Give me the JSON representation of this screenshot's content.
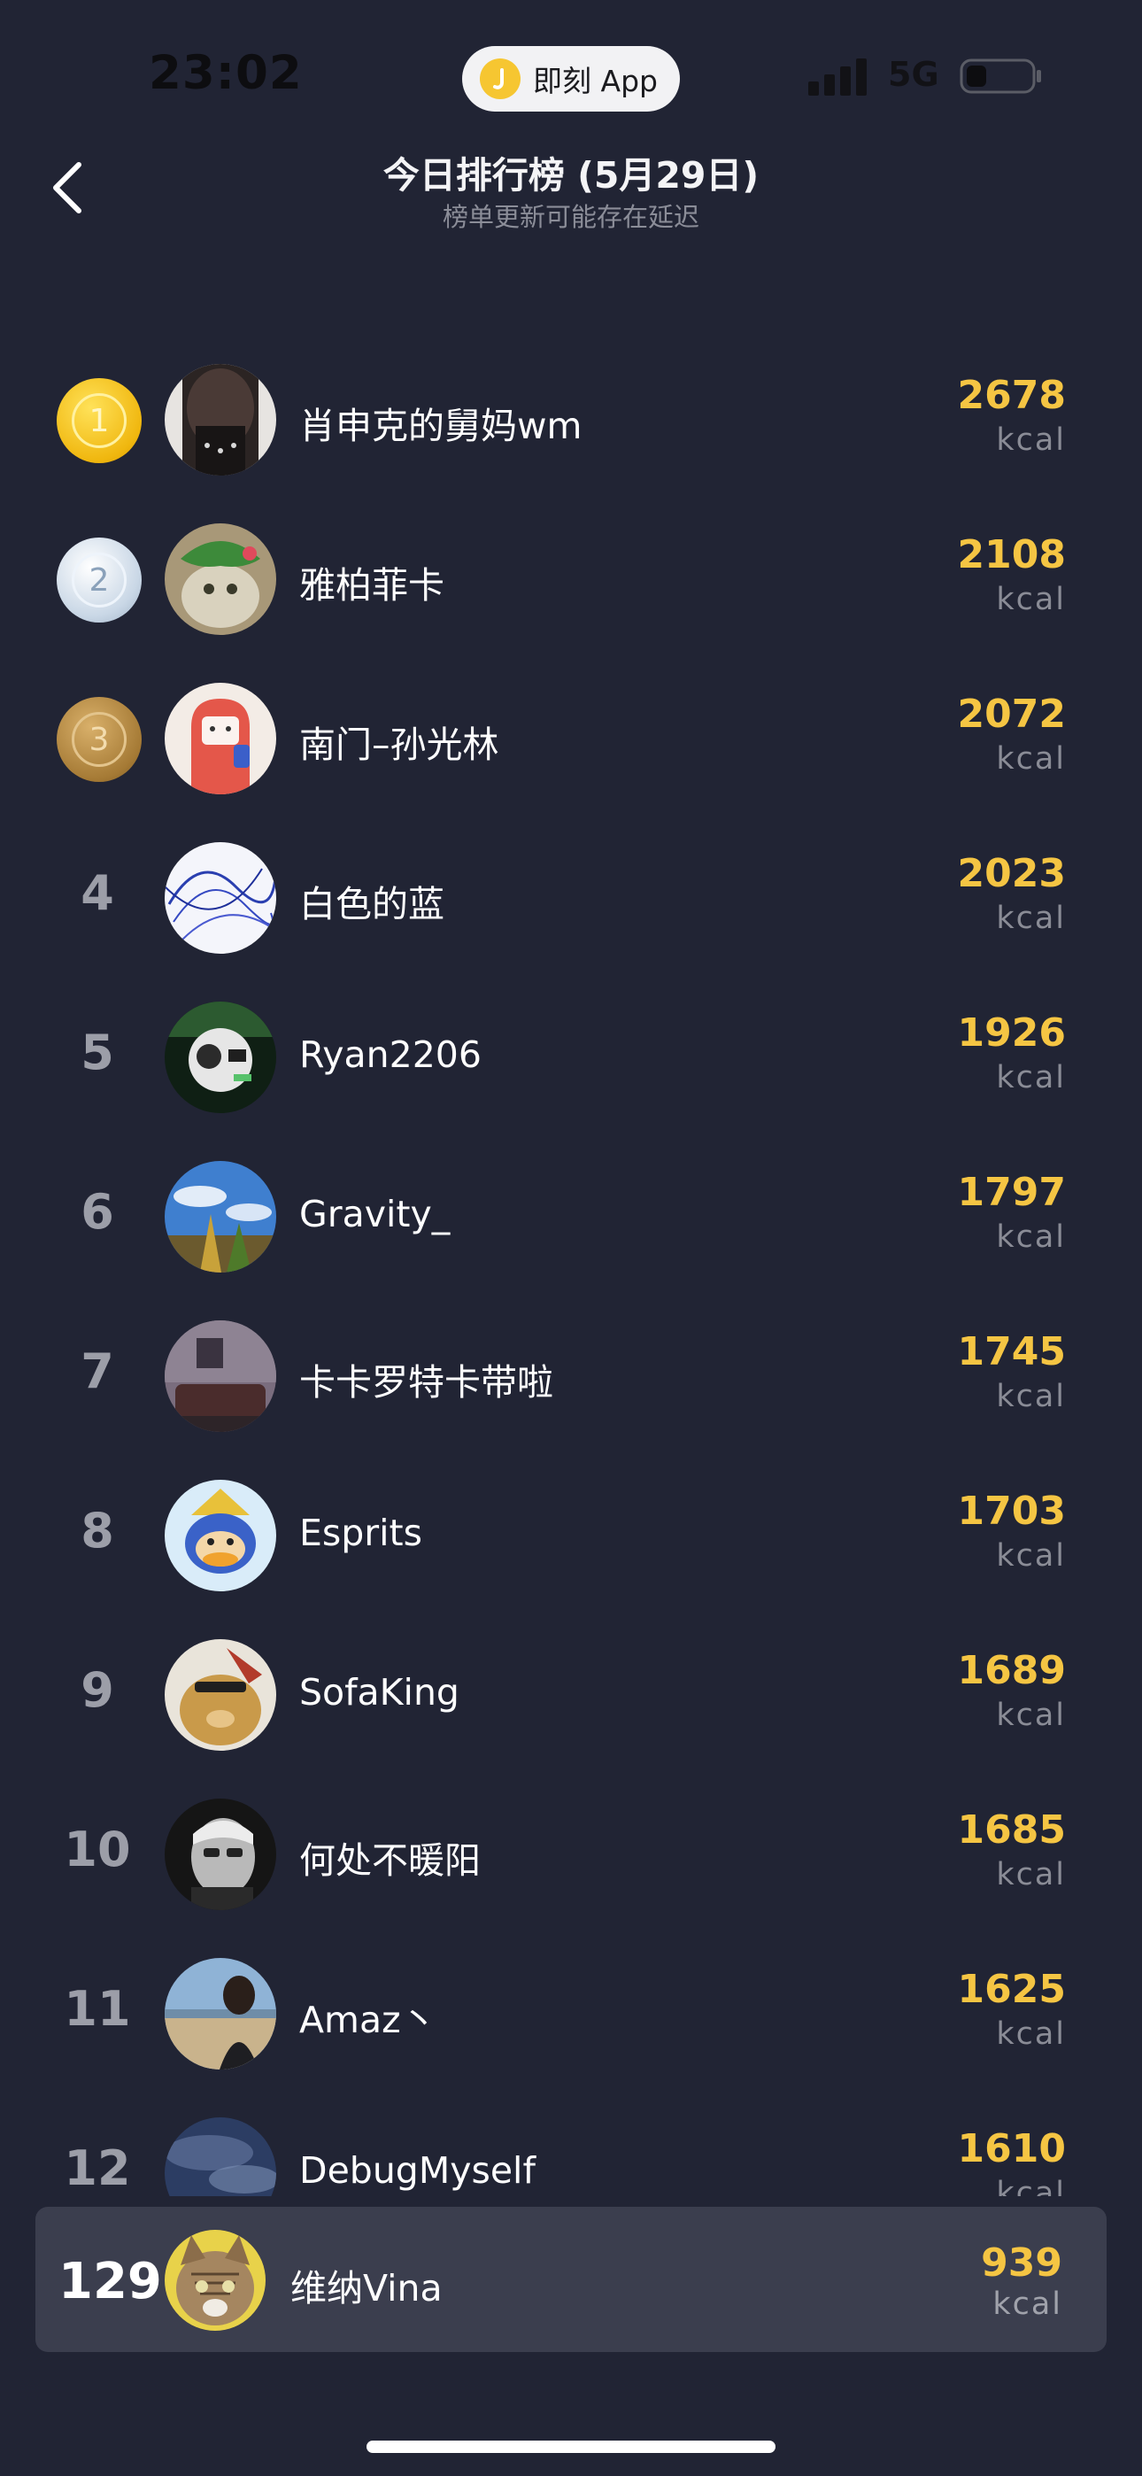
{
  "status_bar": {
    "time": "23:02",
    "app_name": "即刻 App",
    "network": "5G"
  },
  "header": {
    "title": "今日排行榜 (5月29日)",
    "subtitle": "榜单更新可能存在延迟"
  },
  "ranking": [
    {
      "rank": "1",
      "name": "肖申克的舅妈wm",
      "score": "2678",
      "unit": "kcal",
      "medal": "gold"
    },
    {
      "rank": "2",
      "name": "雅柏菲卡",
      "score": "2108",
      "unit": "kcal",
      "medal": "silver"
    },
    {
      "rank": "3",
      "name": "南门–孙光林",
      "score": "2072",
      "unit": "kcal",
      "medal": "bronze"
    },
    {
      "rank": "4",
      "name": "白色的蓝",
      "score": "2023",
      "unit": "kcal"
    },
    {
      "rank": "5",
      "name": "Ryan2206",
      "score": "1926",
      "unit": "kcal"
    },
    {
      "rank": "6",
      "name": "Gravity_",
      "score": "1797",
      "unit": "kcal"
    },
    {
      "rank": "7",
      "name": "卡卡罗特卡带啦",
      "score": "1745",
      "unit": "kcal"
    },
    {
      "rank": "8",
      "name": "Esprits",
      "score": "1703",
      "unit": "kcal"
    },
    {
      "rank": "9",
      "name": "SofaKing",
      "score": "1689",
      "unit": "kcal"
    },
    {
      "rank": "10",
      "name": "何处不暖阳",
      "score": "1685",
      "unit": "kcal"
    },
    {
      "rank": "11",
      "name": "Amaz丶",
      "score": "1625",
      "unit": "kcal"
    },
    {
      "rank": "12",
      "name": "DebugMyself",
      "score": "1610",
      "unit": "kcal"
    }
  ],
  "self": {
    "rank": "129",
    "name": "维纳Vina",
    "score": "939",
    "unit": "kcal"
  },
  "colors": {
    "background": "#212434",
    "score": "#f5c543",
    "self_row": "#3b3e4e"
  }
}
